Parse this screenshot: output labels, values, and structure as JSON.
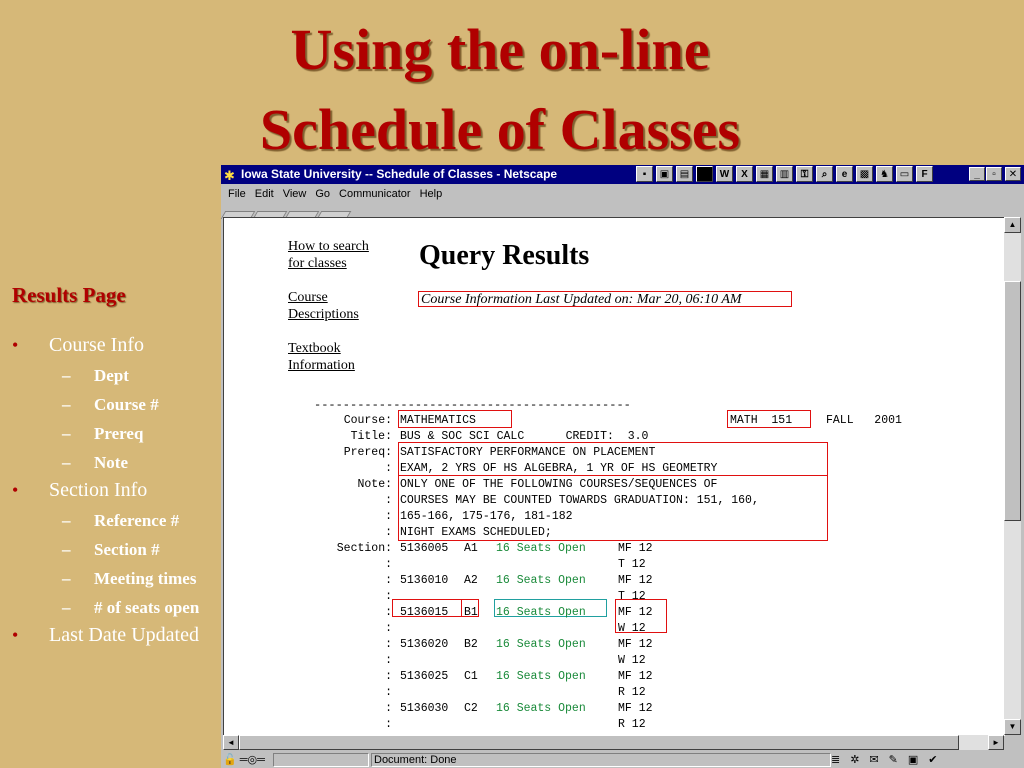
{
  "slide": {
    "title_line1": "Using the on-line",
    "title_line2": "Schedule of Classes",
    "side_heading": "Results Page",
    "bullets": [
      {
        "label": "Course Info",
        "sub": [
          "Dept",
          "Course #",
          "Prereq",
          "Note"
        ]
      },
      {
        "label": "Section Info",
        "sub": [
          "Reference #",
          "Section #",
          "Meeting times",
          "# of seats open"
        ]
      },
      {
        "label": "Last Date Updated",
        "sub": []
      }
    ],
    "bullet_glyph": "•",
    "dash_glyph": "–"
  },
  "window": {
    "title": "Iowa State University -- Schedule of Classes - Netscape",
    "menu": [
      "File",
      "Edit",
      "View",
      "Go",
      "Communicator",
      "Help"
    ]
  },
  "page": {
    "nav_links": [
      "How to search for classes",
      "Course Descriptions",
      "Textbook Information"
    ],
    "heading": "Query Results",
    "updated": "Course Information Last Updated on: Mar 20, 06:10 AM",
    "dashes": "--------------------------------------------",
    "course": {
      "course_label": "Course:",
      "dept": "MATHEMATICS",
      "course_code": "MATH  151",
      "term": "FALL   2001",
      "title_label": "Title:",
      "title": "BUS & SOC SCI CALC      CREDIT:  3.0",
      "prereq_label": "Prereq:",
      "prereq": [
        "SATISFACTORY PERFORMANCE ON PLACEMENT",
        "EXAM, 2 YRS OF HS ALGEBRA, 1 YR OF HS GEOMETRY"
      ],
      "note_label": "Note:",
      "note": [
        "ONLY ONE OF THE FOLLOWING COURSES/SEQUENCES OF",
        "COURSES MAY BE COUNTED TOWARDS GRADUATION: 151, 160,",
        "165-166, 175-176, 181-182",
        "NIGHT EXAMS SCHEDULED;"
      ],
      "colon": ":",
      "section_label": "Section:"
    },
    "sections": [
      {
        "ref": "5136005",
        "sec": "A1",
        "seats": "16 Seats Open",
        "times": [
          "MF 12",
          "T 12"
        ]
      },
      {
        "ref": "5136010",
        "sec": "A2",
        "seats": "16 Seats Open",
        "times": [
          "MF 12",
          "T 12"
        ]
      },
      {
        "ref": "5136015",
        "sec": "B1",
        "seats": "16 Seats Open",
        "times": [
          "MF 12",
          "W 12"
        ]
      },
      {
        "ref": "5136020",
        "sec": "B2",
        "seats": "16 Seats Open",
        "times": [
          "MF 12",
          "W 12"
        ]
      },
      {
        "ref": "5136025",
        "sec": "C1",
        "seats": "16 Seats Open",
        "times": [
          "MF 12",
          "R 12"
        ]
      },
      {
        "ref": "5136030",
        "sec": "C2",
        "seats": "16 Seats Open",
        "times": [
          "MF 12",
          "R 12"
        ]
      }
    ]
  },
  "status": {
    "text": "Document: Done"
  },
  "colors": {
    "slide_bg": "#d6b878",
    "title_red": "#b00000",
    "highlight_red": "#e01010",
    "highlight_teal": "#20a0a0",
    "seats_green": "#1a8a3a",
    "titlebar_navy": "#000080"
  }
}
